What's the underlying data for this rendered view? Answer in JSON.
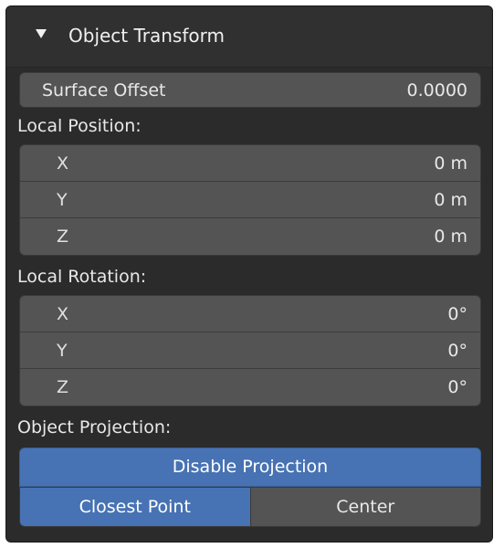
{
  "panel": {
    "title": "Object Transform",
    "surface_offset": {
      "label": "Surface Offset",
      "value": "0.0000"
    },
    "local_position": {
      "label": "Local Position:",
      "rows": [
        {
          "axis": "X",
          "value": "0 m"
        },
        {
          "axis": "Y",
          "value": "0 m"
        },
        {
          "axis": "Z",
          "value": "0 m"
        }
      ]
    },
    "local_rotation": {
      "label": "Local Rotation:",
      "rows": [
        {
          "axis": "X",
          "value": "0°"
        },
        {
          "axis": "Y",
          "value": "0°"
        },
        {
          "axis": "Z",
          "value": "0°"
        }
      ]
    },
    "object_projection": {
      "label": "Object Projection:",
      "disable_label": "Disable Projection",
      "modes": [
        {
          "label": "Closest Point",
          "active": true
        },
        {
          "label": "Center",
          "active": false
        }
      ]
    }
  },
  "colors": {
    "accent": "#4772b3",
    "field_bg": "#545454",
    "panel_bg": "#2b2b2b"
  },
  "icons": {
    "collapse": "triangle-down-icon"
  }
}
